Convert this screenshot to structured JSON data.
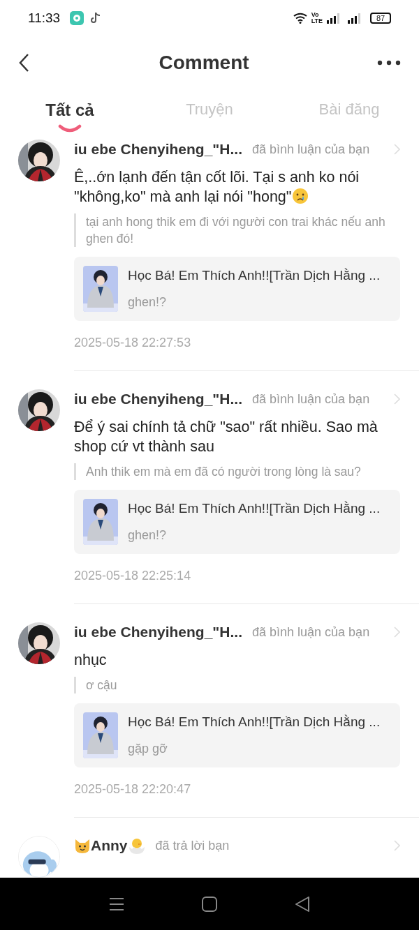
{
  "status_bar": {
    "time": "11:33",
    "network_label": [
      "Vo",
      "LTE"
    ],
    "battery": "87"
  },
  "header": {
    "title": "Comment"
  },
  "tabs": [
    {
      "label": "Tất cả",
      "selected": true
    },
    {
      "label": "Truyện",
      "selected": false
    },
    {
      "label": "Bài đăng",
      "selected": false
    }
  ],
  "notifications": [
    {
      "name": "iu ebe Chenyiheng_\"H...",
      "emoji_name": false,
      "action": "đã bình luận của bạn",
      "text": "Ê,..ớn lạnh đến tận cốt lõi. Tại s anh ko nói \"không,ko\" mà anh lại nói \"hong\"",
      "crying_emoji": true,
      "quote": "tại anh hong thik em đi với người con trai khác nếu anh ghen đó!",
      "card": {
        "title": "Học Bá! Em Thích Anh!![Trần Dịch Hằng ...",
        "subtitle": "ghen!?"
      },
      "time": "2025-05-18 22:27:53"
    },
    {
      "name": "iu ebe Chenyiheng_\"H...",
      "emoji_name": false,
      "action": "đã bình luận của bạn",
      "text": "Để ý sai chính tả chữ \"sao\" rất nhiều. Sao mà shop cứ vt thành sau",
      "crying_emoji": false,
      "quote": "Anh thik em mà em đã có người trong lòng là sau?",
      "card": {
        "title": "Học Bá! Em Thích Anh!![Trần Dịch Hằng ...",
        "subtitle": "ghen!?"
      },
      "time": "2025-05-18 22:25:14"
    },
    {
      "name": "iu ebe Chenyiheng_\"H...",
      "emoji_name": false,
      "action": "đã bình luận của bạn",
      "text": "nhục",
      "crying_emoji": false,
      "quote": "ơ cậu",
      "card": {
        "title": "Học Bá! Em Thích Anh!![Trần Dịch Hằng ...",
        "subtitle": "gặp gỡ"
      },
      "time": "2025-05-18 22:20:47"
    },
    {
      "name": "Anny",
      "emoji_name": true,
      "action": "đã trả lời bạn",
      "crying_emoji": false
    }
  ]
}
